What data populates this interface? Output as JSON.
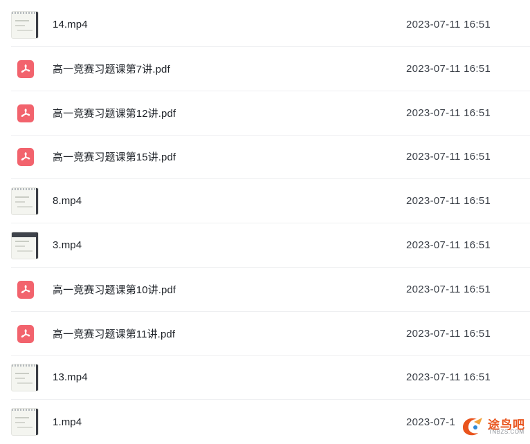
{
  "files": [
    {
      "type": "video",
      "name": "14.mp4",
      "modified": "2023-07-11 16:51"
    },
    {
      "type": "pdf",
      "name": "高一竞赛习题课第7讲.pdf",
      "modified": "2023-07-11 16:51"
    },
    {
      "type": "pdf",
      "name": "高一竞赛习题课第12讲.pdf",
      "modified": "2023-07-11 16:51"
    },
    {
      "type": "pdf",
      "name": "高一竞赛习题课第15讲.pdf",
      "modified": "2023-07-11 16:51"
    },
    {
      "type": "video",
      "name": "8.mp4",
      "modified": "2023-07-11 16:51"
    },
    {
      "type": "video",
      "name": "3.mp4",
      "modified": "2023-07-11 16:51",
      "dark": true
    },
    {
      "type": "pdf",
      "name": "高一竞赛习题课第10讲.pdf",
      "modified": "2023-07-11 16:51"
    },
    {
      "type": "pdf",
      "name": "高一竞赛习题课第11讲.pdf",
      "modified": "2023-07-11 16:51"
    },
    {
      "type": "video",
      "name": "13.mp4",
      "modified": "2023-07-11 16:51"
    },
    {
      "type": "video",
      "name": "1.mp4",
      "modified": "2023-07-1"
    }
  ],
  "watermark": {
    "text": "途鸟吧",
    "subtext": "TNBZS.COM",
    "color": "#e9541d"
  },
  "colors": {
    "pdf_icon": "#f2636d",
    "divider": "#eeeff1",
    "text": "#1f2329"
  }
}
